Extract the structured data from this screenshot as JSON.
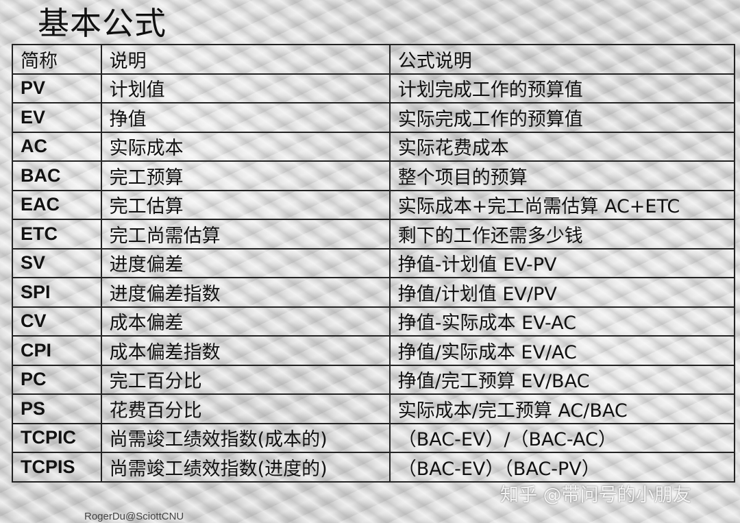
{
  "title": "基本公式",
  "table": {
    "headers": [
      "简称",
      "说明",
      "公式说明"
    ],
    "rows": [
      {
        "abbr": "PV",
        "desc": "计划值",
        "formula": "计划完成工作的预算值"
      },
      {
        "abbr": "EV",
        "desc": "挣值",
        "formula": "实际完成工作的预算值"
      },
      {
        "abbr": "AC",
        "desc": "实际成本",
        "formula": "实际花费成本"
      },
      {
        "abbr": "BAC",
        "desc": "完工预算",
        "formula": "整个项目的预算"
      },
      {
        "abbr": "EAC",
        "desc": "完工估算",
        "formula": "实际成本+完工尚需估算 AC+ETC"
      },
      {
        "abbr": "ETC",
        "desc": "完工尚需估算",
        "formula": "剩下的工作还需多少钱"
      },
      {
        "abbr": "SV",
        "desc": "进度偏差",
        "formula": "挣值-计划值 EV-PV"
      },
      {
        "abbr": "SPI",
        "desc": "进度偏差指数",
        "formula": "挣值/计划值 EV/PV"
      },
      {
        "abbr": "CV",
        "desc": "成本偏差",
        "formula": "挣值-实际成本 EV-AC"
      },
      {
        "abbr": "CPI",
        "desc": "成本偏差指数",
        "formula": "挣值/实际成本 EV/AC"
      },
      {
        "abbr": "PC",
        "desc": "完工百分比",
        "formula": "挣值/完工预算 EV/BAC"
      },
      {
        "abbr": "PS",
        "desc": "花费百分比",
        "formula": "实际成本/完工预算 AC/BAC"
      },
      {
        "abbr": "TCPIC",
        "desc": "尚需竣工绩效指数(成本的)",
        "formula": "（BAC-EV）/（BAC-AC）"
      },
      {
        "abbr": "TCPIS",
        "desc": "尚需竣工绩效指数(进度的)",
        "formula": "（BAC-EV）（BAC-PV）"
      }
    ]
  },
  "watermark": "知乎 @带问号的小朋友",
  "credit": "RogerDu@SciottCNU"
}
